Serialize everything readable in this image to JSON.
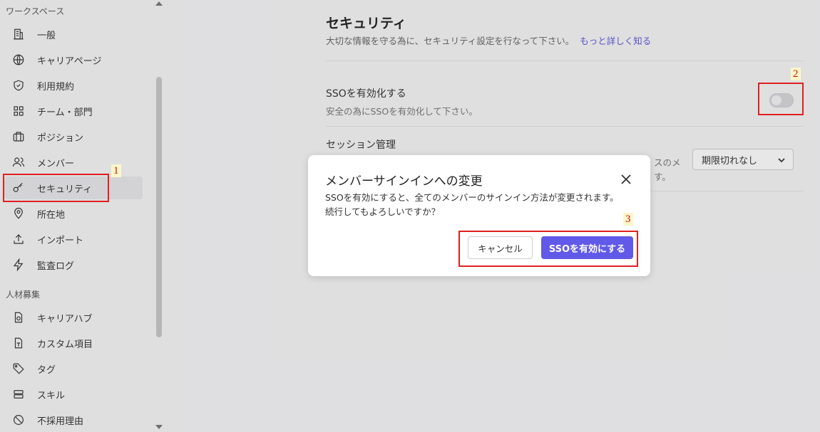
{
  "sidebar": {
    "workspace_label": "ワークスペース",
    "recruit_label": "人材募集",
    "items": [
      {
        "label": "一般",
        "icon": "building-icon"
      },
      {
        "label": "キャリアページ",
        "icon": "globe-icon"
      },
      {
        "label": "利用規約",
        "icon": "shield-icon"
      },
      {
        "label": "チーム・部門",
        "icon": "grid-icon"
      },
      {
        "label": "ポジション",
        "icon": "briefcase-icon"
      },
      {
        "label": "メンバー",
        "icon": "users-icon"
      },
      {
        "label": "セキュリティ",
        "icon": "key-icon"
      },
      {
        "label": "所在地",
        "icon": "location-pin-icon"
      },
      {
        "label": "インポート",
        "icon": "upload-icon"
      },
      {
        "label": "監査ログ",
        "icon": "lightning-icon"
      },
      {
        "label": "キャリアハブ",
        "icon": "gear-document-icon"
      },
      {
        "label": "カスタム項目",
        "icon": "form-document-icon"
      },
      {
        "label": "タグ",
        "icon": "tag-icon"
      },
      {
        "label": "スキル",
        "icon": "stack-icon"
      },
      {
        "label": "不採用理由",
        "icon": "ban-icon"
      }
    ]
  },
  "main": {
    "title": "セキュリティ",
    "description": "大切な情報を守る為に、セキュリティ設定を行なって下さい。",
    "learn_more": "もっと詳しく知る",
    "sso": {
      "title": "SSOを有効化する",
      "description": "安全の為にSSOを有効化して下さい。",
      "enabled": false
    },
    "session": {
      "title": "セッション管理",
      "desc_tail_1": "スのメ",
      "desc_tail_2": "す。",
      "select_value": "期限切れなし"
    }
  },
  "modal": {
    "title": "メンバーサインインへの変更",
    "body_line1": "SSOを有効にすると、全てのメンバーのサインイン方法が変更されます。",
    "body_line2": "続行してもよろしいですか？",
    "cancel_label": "キャンセル",
    "confirm_label": "SSOを有効にする"
  },
  "annotations": {
    "marker1": "1",
    "marker2": "2",
    "marker3": "3",
    "color": "#e02020"
  },
  "colors": {
    "accent": "#6159e8",
    "link": "#5b57d8"
  }
}
